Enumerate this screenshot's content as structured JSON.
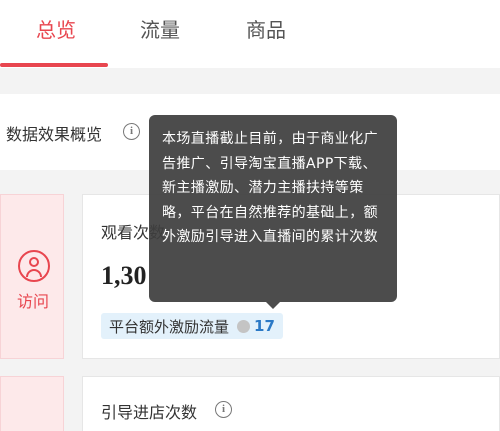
{
  "tabs": [
    {
      "label": "总览",
      "active": true
    },
    {
      "label": "流量",
      "active": false
    },
    {
      "label": "商品",
      "active": false
    }
  ],
  "section": {
    "title": "数据效果概览",
    "info_icon": "info-icon"
  },
  "cards": [
    {
      "side_label": "访问",
      "side_icon": "user-icon",
      "title": "观看次数",
      "value": "1,30",
      "extra": {
        "label": "平台额外激励流量",
        "value": "17"
      }
    },
    {
      "title": "引导进店次数",
      "info_icon": "info-icon"
    }
  ],
  "tooltip": {
    "text": "本场直播截止目前，由于商业化广告推广、引导淘宝直播APP下载、新主播激励、潜力主播扶持等策略，平台在自然推荐的基础上，额外激励引导进入直播间的累计次数"
  },
  "colors": {
    "accent": "#e8464f",
    "pink_bg": "#fde9ea",
    "badge_bg": "#e3f1fb",
    "badge_num": "#2b79c6",
    "tooltip_bg": "#3e3e3e",
    "page_bg": "#f3f3f3"
  }
}
